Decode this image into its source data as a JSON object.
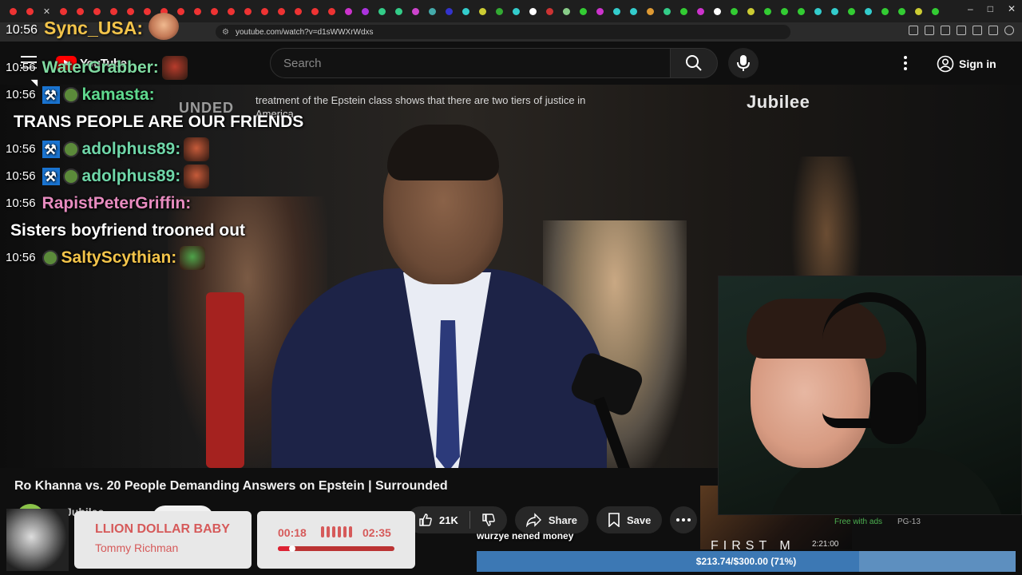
{
  "browser": {
    "url": "youtube.com/watch?v=d1sWWXrWdxs"
  },
  "overlay_clock": "10:56",
  "youtube": {
    "logo_text": "YouTube",
    "search_placeholder": "Search",
    "sign_in": "Sign in"
  },
  "video": {
    "brand": "Jubilee",
    "caption": "treatment of the Epstein class shows that there are two tiers of justice in America",
    "caption_bg": "UNDED"
  },
  "chat": {
    "header_user": "Sync_USA:",
    "lines": [
      {
        "ts": "10:56",
        "user": "WaterGrabber:",
        "color": "#7fd9a0",
        "msg": ""
      },
      {
        "ts": "10:56",
        "user": "kamasta:",
        "color": "#5fd98e",
        "msg": "TRANS PEOPLE ARE OUR FRIENDS"
      },
      {
        "ts": "10:56",
        "user": "adolphus89:",
        "color": "#6fd6a8",
        "msg": ""
      },
      {
        "ts": "10:56",
        "user": "adolphus89:",
        "color": "#6fd6a8",
        "msg": ""
      },
      {
        "ts": "10:56",
        "user": "RapistPeterGriffin:",
        "color": "#e88cc0",
        "msg": "Sisters boyfriend trooned out"
      },
      {
        "ts": "10:56",
        "user": "SaltyScythian:",
        "color": "#f3c44a",
        "msg": ""
      }
    ]
  },
  "video_info": {
    "title": "Ro Khanna vs. 20 People Demanding Answers on Epstein | Surrounded",
    "channel": "Jubilee",
    "likes": "21K",
    "share": "Share",
    "save": "Save"
  },
  "recommended": {
    "free": "Free with ads",
    "rating": "PG-13",
    "duration": "2:21:00",
    "title_art": "FIRST M"
  },
  "music": {
    "song": "LLION DOLLAR BABY",
    "artist": "Tommy Richman",
    "current": "00:18",
    "total": "02:35",
    "progress": 0.12
  },
  "donation": {
    "message": "wurzye nened money",
    "goal_label": "$213.74/$300.00 (71%)",
    "progress": 0.71
  }
}
